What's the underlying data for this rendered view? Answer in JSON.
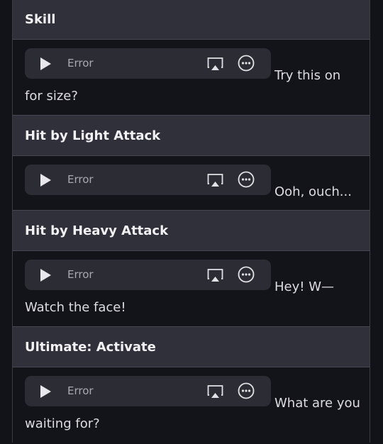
{
  "rows": [
    {
      "header": "Skill",
      "status": "Error",
      "line1": "Try this on",
      "line2": "for size?"
    },
    {
      "header": "Hit by Light Attack",
      "status": "Error",
      "line1": "Ooh, ouch...",
      "line2": ""
    },
    {
      "header": "Hit by Heavy Attack",
      "status": "Error",
      "line1": "Hey! W—",
      "line2": "Watch the face!"
    },
    {
      "header": "Ultimate: Activate",
      "status": "Error",
      "line1": "What are you",
      "line2": "waiting for?"
    }
  ],
  "icons": {
    "play": "play-icon",
    "airplay": "airplay-icon",
    "more": "more-options-icon"
  },
  "colors": {
    "background": "#121219",
    "header_bg": "#2f3039",
    "player_bg": "#2c2d34"
  }
}
